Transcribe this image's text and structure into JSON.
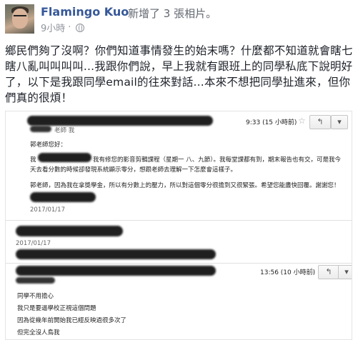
{
  "post": {
    "author": "Flamingo Kuo",
    "action": "新增了 3 張相片。",
    "time": "9小時",
    "separator": "·",
    "text": "鄉民們夠了沒啊？你們知道事情發生的始末嗎？什麼都不知道就會瞎七瞎八亂叫叫叫叫...我跟你們說，早上我就有跟班上的同學私底下說明好了，以下是我跟同學email的往來對話...本來不想把同學扯進來，但你們真的很煩！"
  },
  "screenshot": {
    "email1": {
      "time": "9:33 (15 小時前)",
      "sender_suffix": "老師 我",
      "greeting": "郭老師您好：",
      "body_line1_prefix": "我",
      "body_line1": "我有修您的影音剪輯課程（星期一 八、九節）。我每堂課都有到，期末報告也有交，可是我今",
      "body_line2": "天去看分數的時候卻發現系統顯示零分，想跟老師去理解一下怎麼會這樣子。",
      "body_line3": "郭老師，因為我在拿獎學金，所以有分數上的壓力，所以對這個零分很擔到又很緊張。希望您能盡快回覆。謝謝您！",
      "date": "2017/01/17"
    },
    "email2": {
      "date": "2017/01/17"
    },
    "email3": {
      "time": "13:56 (10 小時前)",
      "line1": "同學不用擔心",
      "line2": "我只是要逼學校正視這個問題",
      "line3": "因為從幾年前開始我已經反映過很多次了",
      "line4": "但完全沒人鳥我"
    },
    "icons": {
      "star": "☆",
      "reply": "↰",
      "caret": "▾"
    }
  }
}
